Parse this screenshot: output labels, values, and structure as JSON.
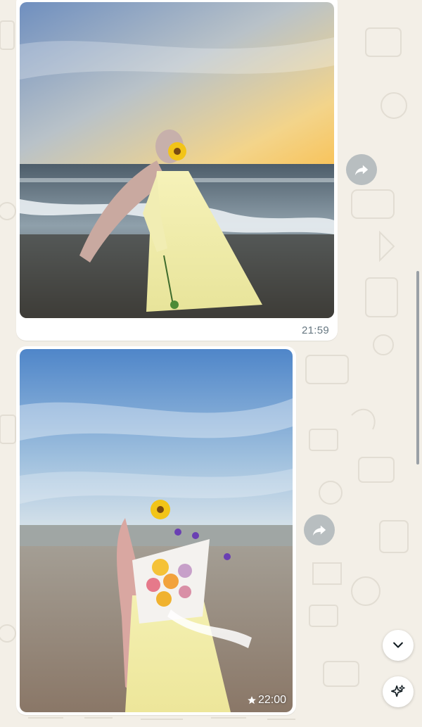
{
  "messages": [
    {
      "type": "image",
      "description_icon": "photo-beach-sunset",
      "timestamp": "21:59",
      "starred": false
    },
    {
      "type": "image",
      "description_icon": "photo-beach-flowers",
      "timestamp": "22:00",
      "starred": true,
      "star_icon": "star-icon"
    }
  ],
  "actions": {
    "forward_icon": "forward-icon",
    "scroll_down_icon": "chevron-down-icon",
    "ai_icon": "sparkle-icon"
  },
  "colors": {
    "chat_background": "#f3efe7",
    "bubble": "#ffffff",
    "timestamp": "#667781",
    "forward_button": "#8696a0"
  }
}
